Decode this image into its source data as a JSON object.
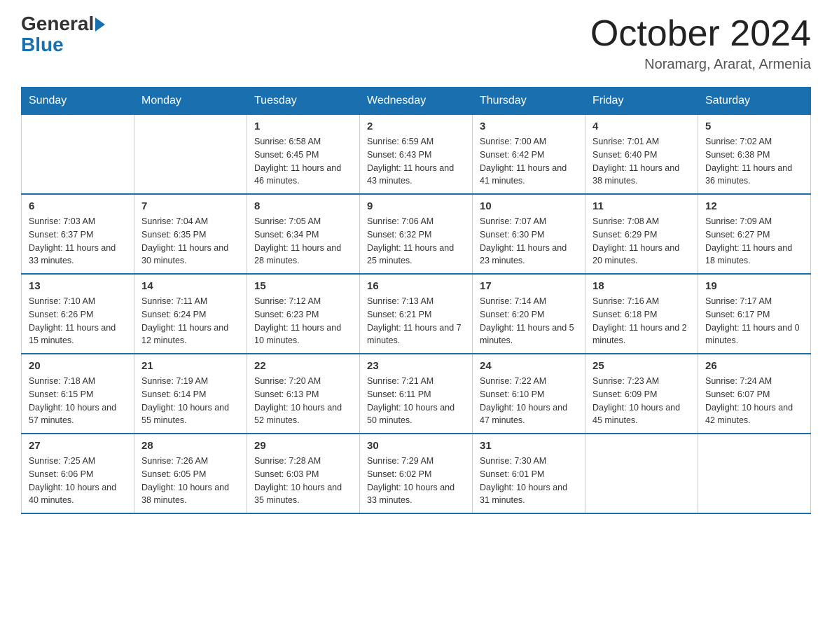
{
  "logo": {
    "general": "General",
    "blue": "Blue"
  },
  "title": "October 2024",
  "subtitle": "Noramarg, Ararat, Armenia",
  "days_of_week": [
    "Sunday",
    "Monday",
    "Tuesday",
    "Wednesday",
    "Thursday",
    "Friday",
    "Saturday"
  ],
  "weeks": [
    [
      {
        "day": "",
        "info": ""
      },
      {
        "day": "",
        "info": ""
      },
      {
        "day": "1",
        "info": "Sunrise: 6:58 AM\nSunset: 6:45 PM\nDaylight: 11 hours\nand 46 minutes."
      },
      {
        "day": "2",
        "info": "Sunrise: 6:59 AM\nSunset: 6:43 PM\nDaylight: 11 hours\nand 43 minutes."
      },
      {
        "day": "3",
        "info": "Sunrise: 7:00 AM\nSunset: 6:42 PM\nDaylight: 11 hours\nand 41 minutes."
      },
      {
        "day": "4",
        "info": "Sunrise: 7:01 AM\nSunset: 6:40 PM\nDaylight: 11 hours\nand 38 minutes."
      },
      {
        "day": "5",
        "info": "Sunrise: 7:02 AM\nSunset: 6:38 PM\nDaylight: 11 hours\nand 36 minutes."
      }
    ],
    [
      {
        "day": "6",
        "info": "Sunrise: 7:03 AM\nSunset: 6:37 PM\nDaylight: 11 hours\nand 33 minutes."
      },
      {
        "day": "7",
        "info": "Sunrise: 7:04 AM\nSunset: 6:35 PM\nDaylight: 11 hours\nand 30 minutes."
      },
      {
        "day": "8",
        "info": "Sunrise: 7:05 AM\nSunset: 6:34 PM\nDaylight: 11 hours\nand 28 minutes."
      },
      {
        "day": "9",
        "info": "Sunrise: 7:06 AM\nSunset: 6:32 PM\nDaylight: 11 hours\nand 25 minutes."
      },
      {
        "day": "10",
        "info": "Sunrise: 7:07 AM\nSunset: 6:30 PM\nDaylight: 11 hours\nand 23 minutes."
      },
      {
        "day": "11",
        "info": "Sunrise: 7:08 AM\nSunset: 6:29 PM\nDaylight: 11 hours\nand 20 minutes."
      },
      {
        "day": "12",
        "info": "Sunrise: 7:09 AM\nSunset: 6:27 PM\nDaylight: 11 hours\nand 18 minutes."
      }
    ],
    [
      {
        "day": "13",
        "info": "Sunrise: 7:10 AM\nSunset: 6:26 PM\nDaylight: 11 hours\nand 15 minutes."
      },
      {
        "day": "14",
        "info": "Sunrise: 7:11 AM\nSunset: 6:24 PM\nDaylight: 11 hours\nand 12 minutes."
      },
      {
        "day": "15",
        "info": "Sunrise: 7:12 AM\nSunset: 6:23 PM\nDaylight: 11 hours\nand 10 minutes."
      },
      {
        "day": "16",
        "info": "Sunrise: 7:13 AM\nSunset: 6:21 PM\nDaylight: 11 hours\nand 7 minutes."
      },
      {
        "day": "17",
        "info": "Sunrise: 7:14 AM\nSunset: 6:20 PM\nDaylight: 11 hours\nand 5 minutes."
      },
      {
        "day": "18",
        "info": "Sunrise: 7:16 AM\nSunset: 6:18 PM\nDaylight: 11 hours\nand 2 minutes."
      },
      {
        "day": "19",
        "info": "Sunrise: 7:17 AM\nSunset: 6:17 PM\nDaylight: 11 hours\nand 0 minutes."
      }
    ],
    [
      {
        "day": "20",
        "info": "Sunrise: 7:18 AM\nSunset: 6:15 PM\nDaylight: 10 hours\nand 57 minutes."
      },
      {
        "day": "21",
        "info": "Sunrise: 7:19 AM\nSunset: 6:14 PM\nDaylight: 10 hours\nand 55 minutes."
      },
      {
        "day": "22",
        "info": "Sunrise: 7:20 AM\nSunset: 6:13 PM\nDaylight: 10 hours\nand 52 minutes."
      },
      {
        "day": "23",
        "info": "Sunrise: 7:21 AM\nSunset: 6:11 PM\nDaylight: 10 hours\nand 50 minutes."
      },
      {
        "day": "24",
        "info": "Sunrise: 7:22 AM\nSunset: 6:10 PM\nDaylight: 10 hours\nand 47 minutes."
      },
      {
        "day": "25",
        "info": "Sunrise: 7:23 AM\nSunset: 6:09 PM\nDaylight: 10 hours\nand 45 minutes."
      },
      {
        "day": "26",
        "info": "Sunrise: 7:24 AM\nSunset: 6:07 PM\nDaylight: 10 hours\nand 42 minutes."
      }
    ],
    [
      {
        "day": "27",
        "info": "Sunrise: 7:25 AM\nSunset: 6:06 PM\nDaylight: 10 hours\nand 40 minutes."
      },
      {
        "day": "28",
        "info": "Sunrise: 7:26 AM\nSunset: 6:05 PM\nDaylight: 10 hours\nand 38 minutes."
      },
      {
        "day": "29",
        "info": "Sunrise: 7:28 AM\nSunset: 6:03 PM\nDaylight: 10 hours\nand 35 minutes."
      },
      {
        "day": "30",
        "info": "Sunrise: 7:29 AM\nSunset: 6:02 PM\nDaylight: 10 hours\nand 33 minutes."
      },
      {
        "day": "31",
        "info": "Sunrise: 7:30 AM\nSunset: 6:01 PM\nDaylight: 10 hours\nand 31 minutes."
      },
      {
        "day": "",
        "info": ""
      },
      {
        "day": "",
        "info": ""
      }
    ]
  ]
}
